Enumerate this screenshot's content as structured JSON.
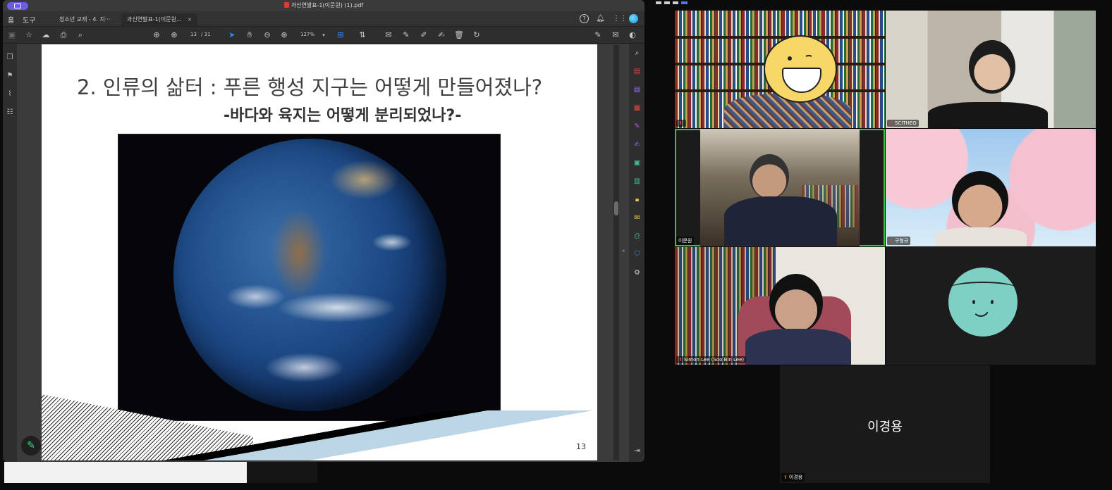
{
  "acrobat": {
    "file_title": "과신연발표-1(이문원) (1).pdf",
    "menu": {
      "home": "홈",
      "tools": "도구"
    },
    "tabs": [
      {
        "label": "청소년 교재 - 4. 지···",
        "active": false
      },
      {
        "label": "과신연발표-1(이문원...",
        "active": true,
        "close": "×"
      }
    ],
    "toolbar": {
      "page_current": "13",
      "page_total": "/ 31",
      "zoom": "127%"
    },
    "icons": {
      "top_right": [
        "help-icon",
        "bell-icon",
        "apps-grid-icon",
        "account-avatar-icon"
      ],
      "toolbar": [
        "save-icon",
        "star-icon",
        "upload-cloud-icon",
        "print-icon",
        "search-icon",
        "page-up-icon",
        "page-down-icon",
        "select-cursor-icon",
        "hand-icon",
        "zoom-out-icon",
        "zoom-in-icon",
        "fit-page-icon",
        "scroll-mode-icon",
        "comment-icon",
        "pen-icon",
        "highlight-icon",
        "sign-icon",
        "delete-icon",
        "rotate-icon",
        "edit-sign-icon",
        "mail-icon",
        "account-icon"
      ],
      "left_rail": [
        "pages-icon",
        "bookmark-icon",
        "attachment-icon",
        "layers-icon"
      ],
      "right_rail": [
        "zoom-icon",
        "create-pdf-icon",
        "export-pdf-icon",
        "organize-pages-icon",
        "edit-pdf-icon",
        "fill-sign-icon",
        "combine-files-icon",
        "compare-icon",
        "protect-icon",
        "comment-tool-icon",
        "print-production-icon",
        "shield-icon",
        "more-tools-icon",
        "collapse-panel-icon"
      ]
    },
    "slide": {
      "title": "2. 인류의 삶터 : 푸른 행성 지구는 어떻게 만들어졌나?",
      "subtitle": "-바다와 육지는 어떻게 분리되었나?-",
      "page_number": "13"
    }
  },
  "zoom": {
    "participants": [
      {
        "name": "",
        "avatar": "yellow-laughing-emoji"
      },
      {
        "name": "SCITHEO"
      },
      {
        "name": "이문원",
        "speaking": true
      },
      {
        "name": "구형규"
      },
      {
        "name": "Simon Lee (Soo Bin Lee)"
      },
      {
        "name": "",
        "avatar": "teal-smiling-emoji"
      },
      {
        "name": "이경용",
        "display_name": "이경용"
      }
    ],
    "colors": {
      "speaking_border": "#3fbf3f",
      "muted_mic": "#e04040"
    }
  }
}
